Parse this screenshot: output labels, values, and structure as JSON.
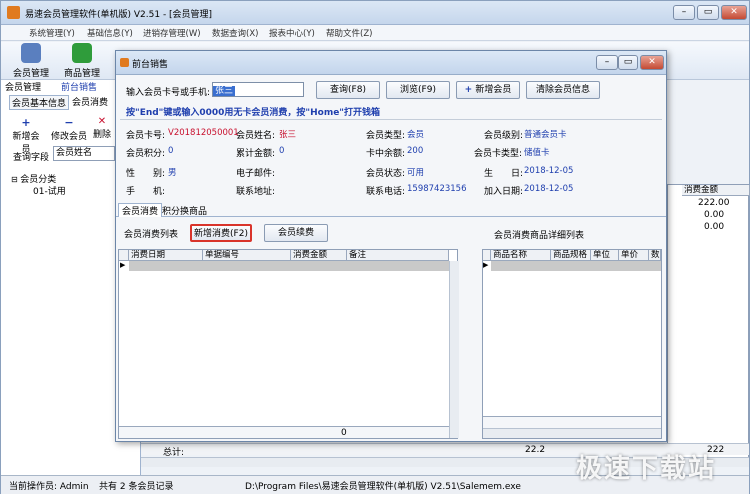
{
  "window": {
    "title": "易速会员管理软件(单机版) V2.51 - [会员管理]",
    "controls": [
      "–",
      "▭",
      "✕"
    ]
  },
  "menu": [
    "系统管理(Y)",
    "基础信息(Y)",
    "进销存管理(W)",
    "数据查询(X)",
    "报表中心(Y)",
    "帮助文件(Z)"
  ],
  "toolbar": [
    {
      "label": "会员管理",
      "icon": "members-icon",
      "color": "#5a7fbf"
    },
    {
      "label": "商品管理",
      "icon": "add-product-icon",
      "color": "#2f9c3b"
    },
    {
      "label": "前台",
      "icon": "front-desk-icon",
      "color": "#3f73c4"
    }
  ],
  "left": {
    "tab_main": "会员管理",
    "tab_sub": "前台销售",
    "tabs": [
      "会员基本信息",
      "会员消费"
    ],
    "actions": [
      "新增会员",
      "修改会员",
      "删除"
    ],
    "search_label": "查询字段",
    "search_field": "会员姓名",
    "tree_root": "会员分类",
    "tree_child": "01-试用"
  },
  "right_grid": {
    "header": "消费金额",
    "values": [
      "222.00",
      "0.00",
      "0.00"
    ],
    "footer_total": "总计:",
    "footer_values": [
      "22.2",
      "222"
    ]
  },
  "status": {
    "operator": "当前操作员: Admin",
    "records": "共有 2 条会员记录",
    "path": "D:\\Program Files\\易速会员管理软件(单机版) V2.51\\Salemem.exe"
  },
  "watermark": "极速下载站",
  "dialog": {
    "title": "前台销售",
    "card_label": "输入会员卡号或手机:",
    "card_value": "张三",
    "buttons": {
      "query": "查询(F8)",
      "browse": "浏览(F9)",
      "add": "新增会员",
      "clear": "清除会员信息"
    },
    "hint": "按\"End\"键或输入0000用无卡会员消费，按\"Home\"打开钱箱",
    "info": {
      "card_no_l": "会员卡号:",
      "card_no": "V201812050001",
      "name_l": "会员姓名:",
      "name": "张三",
      "type_l": "会员类型:",
      "type": "会员",
      "level_l": "会员级别:",
      "level": "普通会员卡",
      "points_l": "会员积分:",
      "points": "0",
      "total_l": "累计金额:",
      "total": "0",
      "balance_l": "卡中余额:",
      "balance": "200",
      "cardtype_l": "会员卡类型:",
      "cardtype": "储值卡",
      "gender_l": "性　　别:",
      "gender": "男",
      "email_l": "电子邮件:",
      "email": "",
      "status_l": "会员状态:",
      "status": "可用",
      "birthday_l": "生　　日:",
      "birthday": "2018-12-05",
      "phone_l": "手　　机:",
      "phone": "",
      "addr_l": "联系地址:",
      "addr": "",
      "tel_l": "联系电话:",
      "tel": "15987423156",
      "join_l": "加入日期:",
      "join": "2018-12-05"
    },
    "tabs": [
      "会员消费",
      "积分换商品"
    ],
    "consume_list_label": "会员消费列表",
    "new_consume": "新增消费(F2)",
    "renew": "会员续费",
    "detail_label": "会员消费商品详细列表",
    "grid1_cols": [
      "消费日期",
      "单据编号",
      "消费金额",
      "备注"
    ],
    "grid1_total": "0",
    "grid2_cols": [
      "商品名称",
      "商品规格",
      "单位",
      "单价",
      "数"
    ]
  },
  "colors": {
    "accent": "#1f3fae",
    "highlight": "#d9342b",
    "title_bar": "#c5d6ec"
  }
}
